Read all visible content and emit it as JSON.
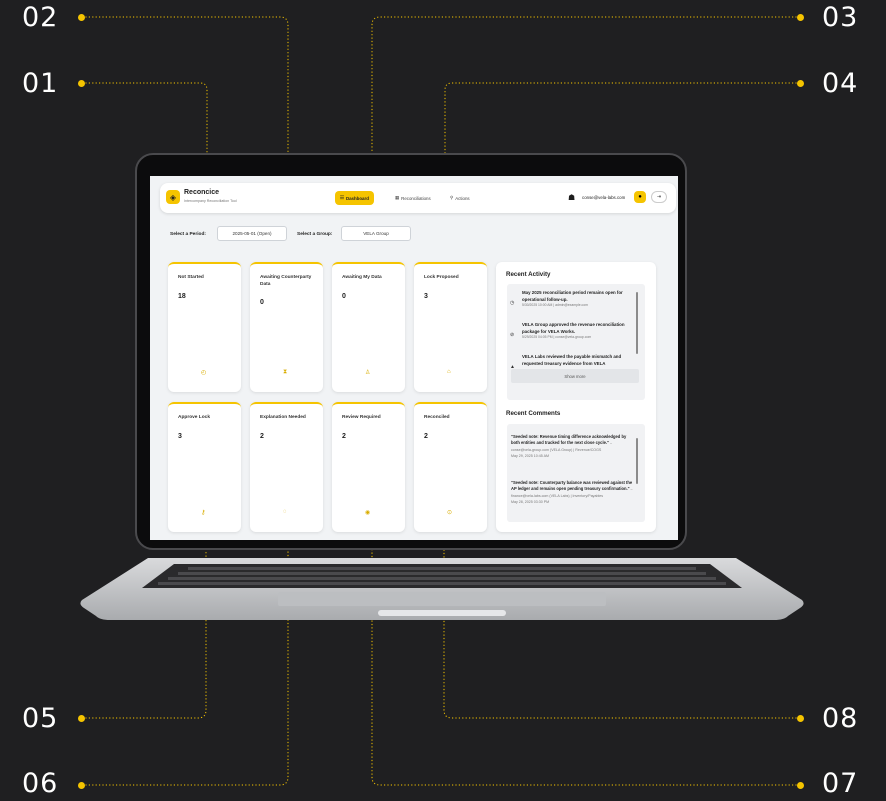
{
  "callouts": {
    "c01": "01",
    "c02": "02",
    "c03": "03",
    "c04": "04",
    "c05": "05",
    "c06": "06",
    "c07": "07",
    "c08": "08"
  },
  "colors": {
    "accent": "#f5c400",
    "background": "#1f1f21"
  },
  "app": {
    "title": "Reconcice",
    "subtitle": "Intercompany Reconciliation Tool",
    "nav": {
      "dashboard": "Dashboard",
      "reconciliations": "Reconciliations",
      "actions": "Actions"
    },
    "user": {
      "email": "conse@vela-labs.com",
      "icon": "robot-icon"
    }
  },
  "filters": {
    "period_label": "Select a Period:",
    "period_value": "2025-05-01 (Open)",
    "group_label": "Select a Group:",
    "group_value": "VELA Group"
  },
  "cards": [
    {
      "title": "Not Started",
      "value": "18",
      "icon": "clock-icon"
    },
    {
      "title": "Awaiting Counterparty Data",
      "value": "0",
      "icon": "hourglass-icon"
    },
    {
      "title": "Awaiting My Data",
      "value": "0",
      "icon": "user-icon"
    },
    {
      "title": "Lock Proposed",
      "value": "3",
      "icon": "lock-icon"
    },
    {
      "title": "Approve Lock",
      "value": "3",
      "icon": "key-icon"
    },
    {
      "title": "Explanation Needed",
      "value": "2",
      "icon": "comment-icon"
    },
    {
      "title": "Review Required",
      "value": "2",
      "icon": "eye-icon"
    },
    {
      "title": "Reconciled",
      "value": "2",
      "icon": "check-circle-icon"
    }
  ],
  "recent_activity": {
    "heading": "Recent Activity",
    "items": [
      {
        "text": "May 2025 reconciliation period remains open for operational follow-up.",
        "meta": "5/30/2025 10:00 AM | admin@example.com",
        "icon": "clock-icon"
      },
      {
        "text": "VELA Group approved the revenue reconciliation package for VELA Works.",
        "meta": "5/29/2025 04:05 PM | conse@vela-group.com",
        "icon": "check-circle-icon"
      },
      {
        "text": "VELA Labs reviewed the payable mismatch and requested treasury evidence from VELA",
        "meta": "",
        "icon": "chevron-up-icon"
      }
    ],
    "show_more": "Show more"
  },
  "recent_comments": {
    "heading": "Recent Comments",
    "items": [
      {
        "quote": "\"Seeded note: Revenue timing difference acknowledged by both entities and tracked for the next close cycle.\"",
        "by": " – conse@vela-group.com (VELA Group) | Revenue/COGS",
        "date": "May 29, 2025 10:45 AM"
      },
      {
        "quote": "\"Seeded note: Counterparty balance was reviewed against the AP ledger and remains open pending treasury confirmation.\"",
        "by": " – finance@vela-labs.com (VELA Labs) | Inventory/Payables",
        "date": "May 28, 2025 03:30 PM"
      }
    ]
  }
}
